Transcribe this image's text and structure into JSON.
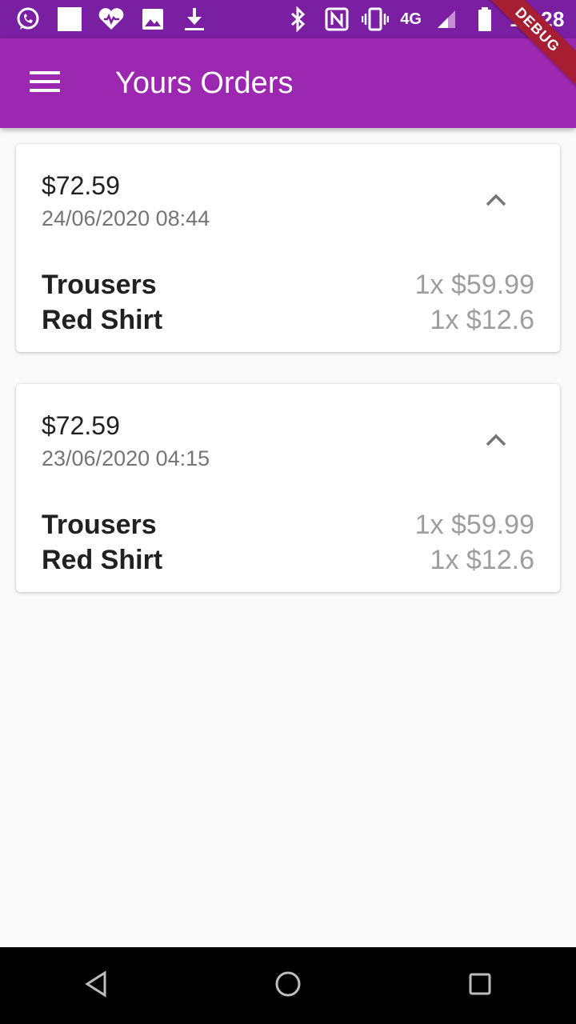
{
  "status_bar": {
    "left_icons": [
      "whatsapp-icon",
      "notification-square-icon",
      "health-heart-icon",
      "gallery-image-icon",
      "download-icon"
    ],
    "right_icons": [
      "bluetooth-icon",
      "nfc-icon",
      "vibrate-icon"
    ],
    "network": "4G",
    "time": "10:28"
  },
  "debug_banner": "DEBUG",
  "app_bar": {
    "title": "Yours Orders",
    "menu_icon": "hamburger-menu-icon",
    "background": "#9c27b0"
  },
  "orders": [
    {
      "total": "$72.59",
      "datetime": "24/06/2020 08:44",
      "expand_icon": "chevron-up-icon",
      "items": [
        {
          "name": "Trousers",
          "qty_price": "1x $59.99"
        },
        {
          "name": "Red Shirt",
          "qty_price": "1x $12.6"
        }
      ]
    },
    {
      "total": "$72.59",
      "datetime": "23/06/2020 04:15",
      "expand_icon": "chevron-up-icon",
      "items": [
        {
          "name": "Trousers",
          "qty_price": "1x $59.99"
        },
        {
          "name": "Red Shirt",
          "qty_price": "1x $12.6"
        }
      ]
    }
  ],
  "nav_bar": {
    "buttons": [
      "back-icon",
      "home-icon",
      "recents-icon"
    ]
  }
}
